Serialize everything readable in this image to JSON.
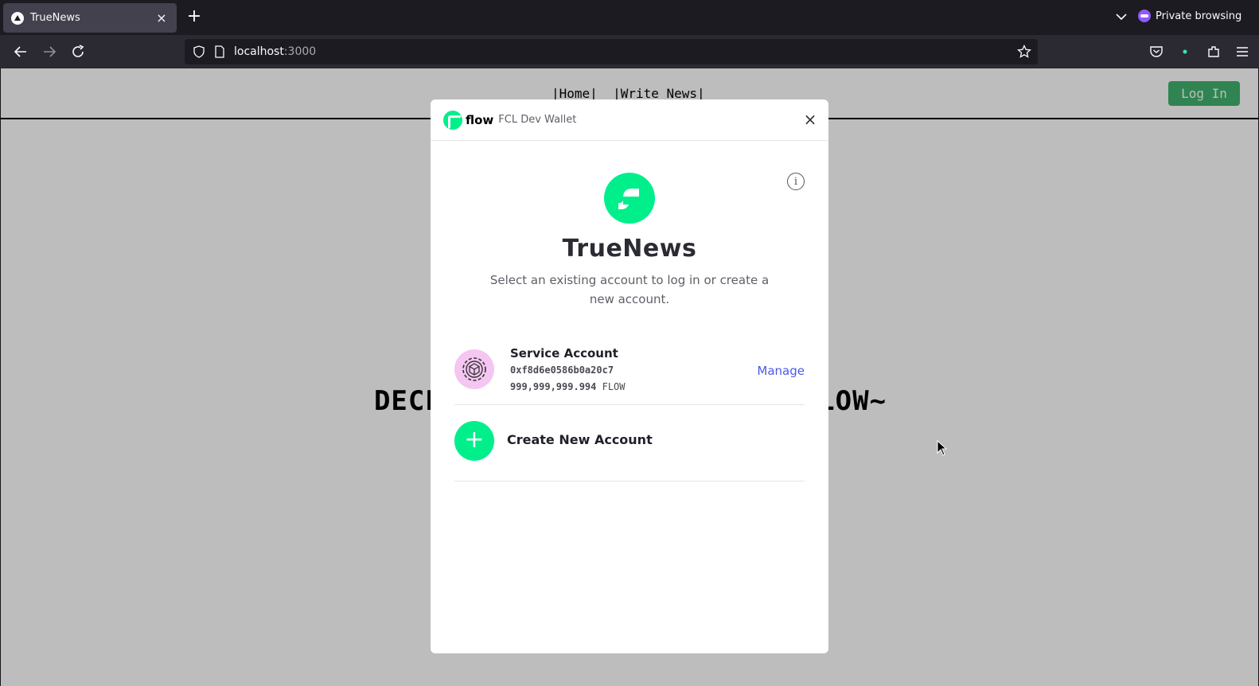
{
  "browser": {
    "tab_title": "TrueNews",
    "tab_close": "×",
    "new_tab": "+",
    "private_label": "Private browsing",
    "url_host": "localhost",
    "url_port": ":3000"
  },
  "site": {
    "nav_text": "|Home|  |Write News|",
    "login_label": "Log In",
    "hero_text": "DECENTRALIZED NEWS USING FLOW~"
  },
  "modal": {
    "brand_word": "flow",
    "wallet_label": "FCL Dev Wallet",
    "close_glyph": "×",
    "info_glyph": "i",
    "app_title": "TrueNews",
    "subtitle": "Select an existing account to log in or create a new account.",
    "account": {
      "name": "Service Account",
      "address": "0xf8d6e0586b0a20c7",
      "balance": "999,999,999.994",
      "unit": "FLOW",
      "manage_label": "Manage"
    },
    "create_label": "Create New Account",
    "create_glyph": "+"
  },
  "colors": {
    "flow_green": "#00ef8b",
    "login_green": "#41b36e",
    "manage_blue": "#4b5ae8",
    "avatar_pink": "#f5c6f2",
    "private_purple": "#9059ff"
  }
}
